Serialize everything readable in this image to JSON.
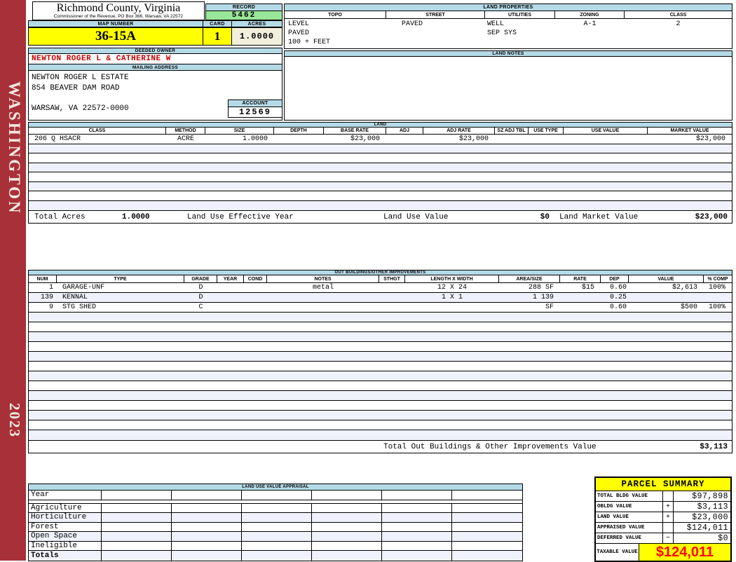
{
  "sidebar": {
    "vertical_label": "WASHINGTON",
    "year": "2023"
  },
  "header": {
    "county": "Richmond County, Virginia",
    "subtitle": "Commissioner of the Revenue, PO Box 366, Warsaw, VA 22572",
    "record_label": "RECORD",
    "record_value": "5462",
    "map_number_label": "MAP NUMBER",
    "map_number": "36-15A",
    "card_label": "CARD",
    "card": "1",
    "acres_label": "ACRES",
    "acres": "1.0000"
  },
  "land_properties": {
    "title": "LAND PROPERTIES",
    "columns": [
      "TOPO",
      "STREET",
      "UTILITIES",
      "ZONING",
      "CLASS"
    ],
    "topo": [
      "LEVEL",
      "PAVED",
      "100 + FEET"
    ],
    "street": "PAVED",
    "utilities": [
      "WELL",
      "SEP SYS"
    ],
    "zoning": "A-1",
    "class": "2"
  },
  "owner": {
    "deeded_owner_label": "DEEDED OWNER",
    "deeded_owner": "NEWTON ROGER L & CATHERINE W",
    "mailing_address_label": "MAILING ADDRESS",
    "address_lines": [
      "NEWTON ROGER L ESTATE",
      "854 BEAVER DAM ROAD",
      "",
      "WARSAW, VA 22572-0000"
    ],
    "account_label": "ACCOUNT",
    "account": "12569"
  },
  "land_notes": {
    "title": "LAND NOTES"
  },
  "land": {
    "title": "LAND",
    "columns": [
      "CLASS",
      "METHOD",
      "SIZE",
      "DEPTH",
      "BASE RATE",
      "ADJ",
      "ADJ RATE",
      "SZ ADJ TBL",
      "USE TYPE",
      "USE VALUE",
      "MARKET VALUE"
    ],
    "rows": [
      [
        "206 Q HSACR",
        "ACRE",
        "1.0000",
        "",
        "$23,000",
        "",
        "$23,000",
        "",
        "",
        "",
        "$23,000"
      ]
    ],
    "empty_row_count": 7,
    "totals": {
      "total_acres_label": "Total Acres",
      "total_acres": "1.0000",
      "effective_year_label": "Land Use Effective Year",
      "use_value_label": "Land Use Value",
      "use_value": "$0",
      "market_value_label": "Land Market Value",
      "market_value": "$23,000"
    }
  },
  "out_buildings": {
    "title": "OUT BUILDINGS/OTHER IMPROVEMENTS",
    "columns": [
      "NUM",
      "TYPE",
      "GRADE",
      "YEAR",
      "COND",
      "NOTES",
      "STHGT",
      "LENGTH X WIDTH",
      "AREA/SIZE",
      "RATE",
      "DEP",
      "VALUE",
      "% COMP"
    ],
    "rows": [
      [
        "1",
        "GARAGE-UNF",
        "D",
        "",
        "",
        "metal",
        "",
        "12 X 24",
        "288 SF",
        "$15",
        "0.60",
        "$2,613",
        "100%"
      ],
      [
        "139",
        "KENNAL",
        "D",
        "",
        "",
        "",
        "",
        "1 X 1",
        "1 139",
        "",
        "0.25",
        "",
        ""
      ],
      [
        "9",
        "STG SHED",
        "C",
        "",
        "",
        "",
        "",
        "",
        "SF",
        "",
        "0.60",
        "$500",
        "100%"
      ]
    ],
    "empty_row_count": 13,
    "total_label": "Total Out Buildings & Other Improvements Value",
    "total_value": "$3,113"
  },
  "land_use_appraisal": {
    "title": "LAND USE VALUE APPRAISAL",
    "row_labels": [
      "Year",
      "Agriculture",
      "Horticulture",
      "Forest",
      "Open Space",
      "Ineligible",
      "Totals"
    ],
    "column_count": 6
  },
  "parcel_summary": {
    "title": "PARCEL SUMMARY",
    "rows": [
      {
        "label": "TOTAL BLDG VALUE",
        "op": "",
        "value": "$97,898"
      },
      {
        "label": "OBLDG VALUE",
        "op": "+",
        "value": "$3,113"
      },
      {
        "label": "LAND VALUE",
        "op": "+",
        "value": "$23,000"
      },
      {
        "label": "APPRAISED VALUE",
        "op": "",
        "value": "$124,011"
      },
      {
        "label": "DEFERRED VALUE",
        "op": "−",
        "value": "$0"
      }
    ],
    "taxable_label": "TAXABLE VALUE",
    "taxable_value": "$124,011"
  },
  "colors": {
    "sidebar_red": "#a83038",
    "header_blue": "#b5dae7",
    "record_green": "#99e699",
    "highlight_yellow": "#ffff00",
    "acres_cream": "#f2f0dd",
    "owner_red": "#cc0000",
    "taxable_red": "#ff0000",
    "row_stripe": "#eff2fa"
  }
}
